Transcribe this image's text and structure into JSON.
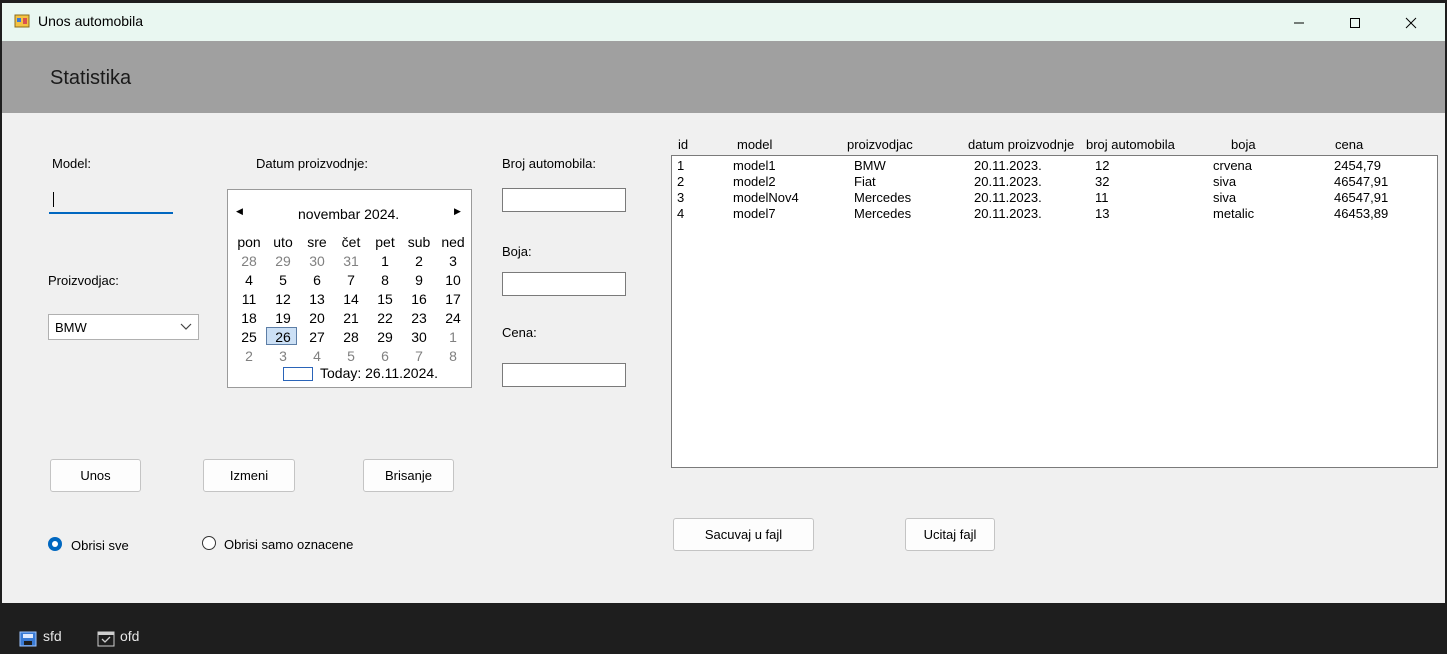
{
  "window": {
    "title": "Unos automobila",
    "minimize": "—",
    "maximize": "☐",
    "close": "✕"
  },
  "header": {
    "title": "Statistika"
  },
  "form": {
    "model_label": "Model:",
    "model_value": "",
    "date_label": "Datum proizvodnje:",
    "manufacturer_label": "Proizvodjac:",
    "manufacturer_value": "BMW",
    "car_number_label": "Broj automobila:",
    "car_number_value": "",
    "color_label": "Boja:",
    "color_value": "",
    "price_label": "Cena:",
    "price_value": ""
  },
  "calendar": {
    "month_label": "novembar 2024.",
    "weekdays": [
      "pon",
      "uto",
      "sre",
      "čet",
      "pet",
      "sub",
      "ned"
    ],
    "weeks": [
      [
        "28",
        "29",
        "30",
        "31",
        "1",
        "2",
        "3"
      ],
      [
        "4",
        "5",
        "6",
        "7",
        "8",
        "9",
        "10"
      ],
      [
        "11",
        "12",
        "13",
        "14",
        "15",
        "16",
        "17"
      ],
      [
        "18",
        "19",
        "20",
        "21",
        "22",
        "23",
        "24"
      ],
      [
        "25",
        "26",
        "27",
        "28",
        "29",
        "30",
        "1"
      ],
      [
        "2",
        "3",
        "4",
        "5",
        "6",
        "7",
        "8"
      ]
    ],
    "today_label": "Today: 26.11.2024."
  },
  "buttons": {
    "insert": "Unos",
    "edit": "Izmeni",
    "delete": "Brisanje",
    "save_file": "Sacuvaj u fajl",
    "load_file": "Ucitaj fajl"
  },
  "radios": {
    "delete_all": "Obrisi sve",
    "delete_selected": "Obrisi samo oznacene"
  },
  "table": {
    "columns": [
      "id",
      "model",
      "proizvodjac",
      "datum proizvodnje",
      "broj automobila",
      "boja",
      "cena"
    ],
    "rows": [
      [
        "1",
        "model1",
        "BMW",
        "20.11.2023.",
        "12",
        "crvena",
        "2454,79"
      ],
      [
        "2",
        "model2",
        "Fiat",
        "20.11.2023.",
        "32",
        "siva",
        "46547,91"
      ],
      [
        "3",
        "modelNov4",
        "Mercedes",
        "20.11.2023.",
        "11",
        "siva",
        "46547,91"
      ],
      [
        "4",
        "model7",
        "Mercedes",
        "20.11.2023.",
        "13",
        "metalic",
        "46453,89"
      ]
    ]
  },
  "tray": {
    "item1": "sfd",
    "item2": "ofd"
  }
}
